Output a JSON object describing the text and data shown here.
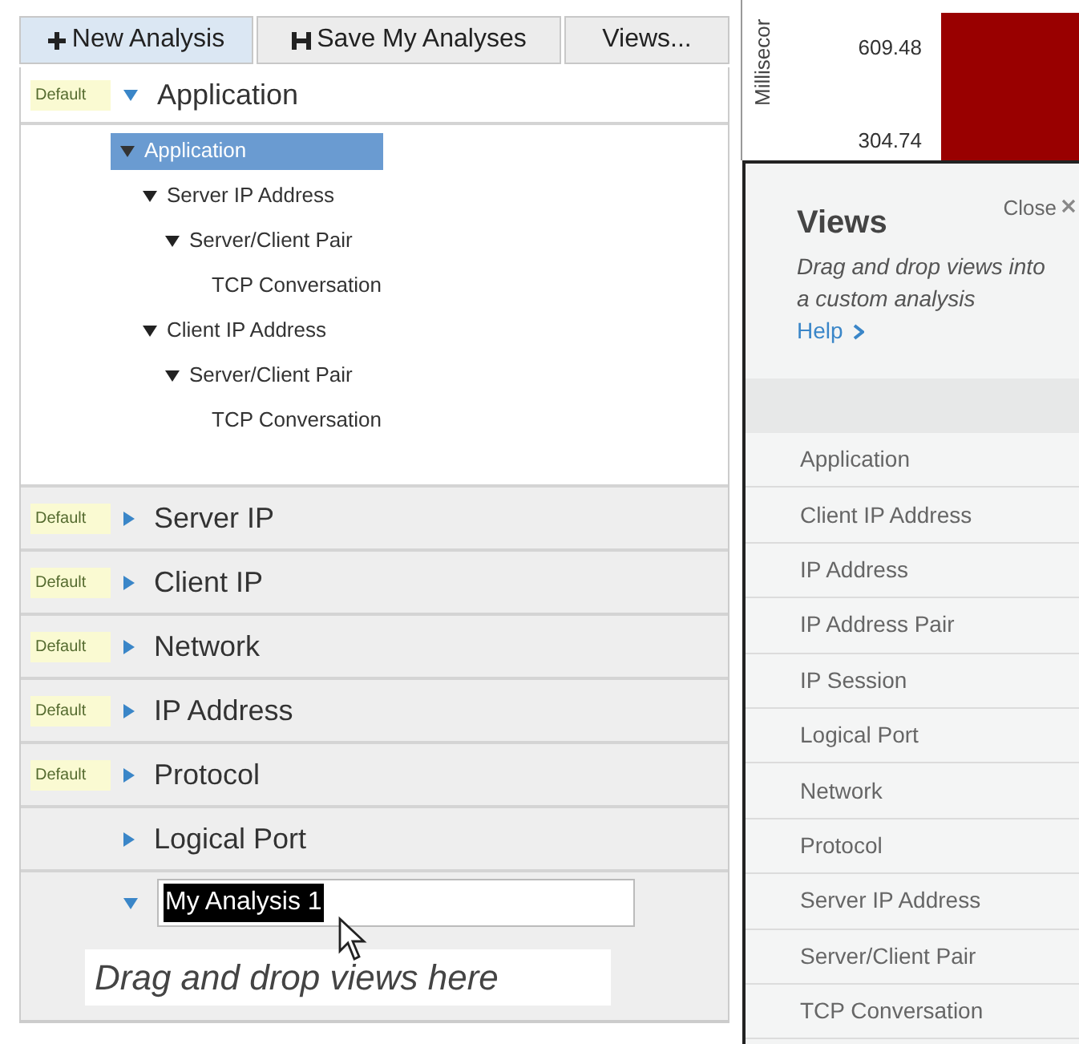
{
  "toolbar": {
    "buttons": [
      {
        "label": "New Analysis",
        "selected": true
      },
      {
        "label": "Save My Analyses",
        "selected": false
      },
      {
        "label": "Views...",
        "selected": false
      }
    ]
  },
  "sections": [
    {
      "kind": "view",
      "expanded": true,
      "label": "Default",
      "title": "Application",
      "tree": [
        {
          "label": "Application",
          "expanded": true,
          "selected": true,
          "children": [
            {
              "label": "Server IP Address",
              "expanded": true,
              "selected": false,
              "children": [
                {
                  "label": "Server/Client Pair",
                  "expanded": true,
                  "selected": false,
                  "children": [
                    {
                      "label": "TCP Conversation",
                      "selected": false
                    }
                  ]
                }
              ]
            },
            {
              "label": "Client IP Address",
              "expanded": true,
              "selected": false,
              "children": [
                {
                  "label": "Server/Client Pair",
                  "expanded": true,
                  "selected": false,
                  "children": [
                    {
                      "label": "TCP Conversation",
                      "selected": false
                    }
                  ]
                }
              ]
            }
          ]
        }
      ]
    },
    {
      "kind": "view",
      "expanded": false,
      "label": "Default",
      "title": "Server IP"
    },
    {
      "kind": "view",
      "expanded": false,
      "label": "Default",
      "title": "Client IP"
    },
    {
      "kind": "view",
      "expanded": false,
      "label": "Default",
      "title": "Network"
    },
    {
      "kind": "view",
      "expanded": false,
      "label": "Default",
      "title": "IP Address"
    },
    {
      "kind": "view",
      "expanded": false,
      "label": "Default",
      "title": "Protocol"
    },
    {
      "kind": "view",
      "expanded": false,
      "title": "Logical Port"
    },
    {
      "kind": "edit",
      "expanded": true,
      "value": "My Analysis 1"
    }
  ],
  "drop_zone": {
    "text": "Drag and drop views here"
  },
  "chart": {
    "ylabel": "Millisecor",
    "ytick_labels": [
      "609.48",
      "304.74"
    ]
  },
  "views_panel": {
    "title": "Views",
    "close": "Close",
    "description": "Drag and drop views into a custom analysis",
    "help": "Help",
    "items": [
      "Application",
      "Client IP Address",
      "IP Address",
      "IP Address Pair",
      "IP Session",
      "Logical Port",
      "Network",
      "Protocol",
      "Server IP Address",
      "Server/Client Pair",
      "TCP Conversation"
    ]
  }
}
